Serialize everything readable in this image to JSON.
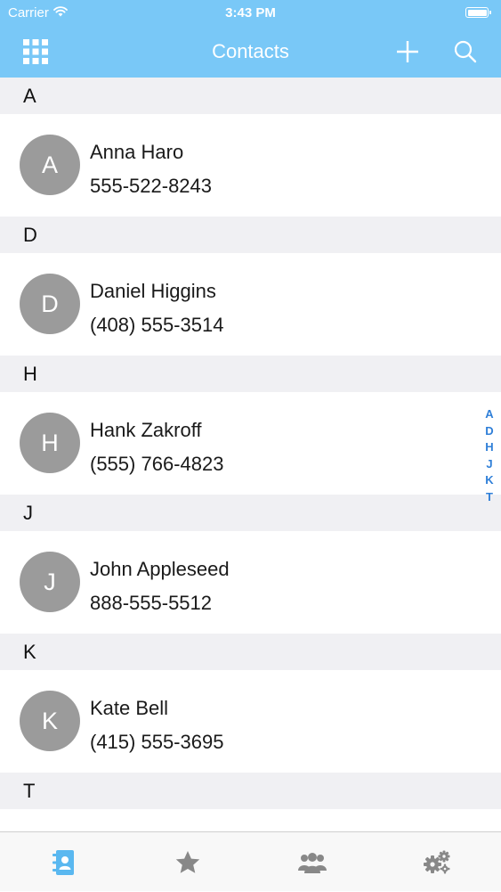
{
  "status": {
    "carrier": "Carrier",
    "time": "3:43 PM"
  },
  "header": {
    "title": "Contacts"
  },
  "sections": [
    {
      "letter": "A",
      "contacts": [
        {
          "initial": "A",
          "name": "Anna Haro",
          "phone": "555-522-8243"
        }
      ]
    },
    {
      "letter": "D",
      "contacts": [
        {
          "initial": "D",
          "name": "Daniel Higgins",
          "phone": "(408) 555-3514"
        }
      ]
    },
    {
      "letter": "H",
      "contacts": [
        {
          "initial": "H",
          "name": "Hank Zakroff",
          "phone": "(555) 766-4823"
        }
      ]
    },
    {
      "letter": "J",
      "contacts": [
        {
          "initial": "J",
          "name": "John Appleseed",
          "phone": "888-555-5512"
        }
      ]
    },
    {
      "letter": "K",
      "contacts": [
        {
          "initial": "K",
          "name": "Kate Bell",
          "phone": "(415) 555-3695"
        }
      ]
    },
    {
      "letter": "T",
      "contacts": []
    }
  ],
  "index": [
    "A",
    "D",
    "H",
    "J",
    "K",
    "T"
  ],
  "tabs": [
    {
      "icon": "contacts-book-icon",
      "active": true
    },
    {
      "icon": "star-icon",
      "active": false
    },
    {
      "icon": "group-icon",
      "active": false
    },
    {
      "icon": "settings-gears-icon",
      "active": false
    }
  ],
  "colors": {
    "header": "#79c8f7",
    "avatar": "#9b9b9b",
    "index": "#2f7fd8",
    "tab_active": "#5ab8f0",
    "tab_inactive": "#888888"
  }
}
